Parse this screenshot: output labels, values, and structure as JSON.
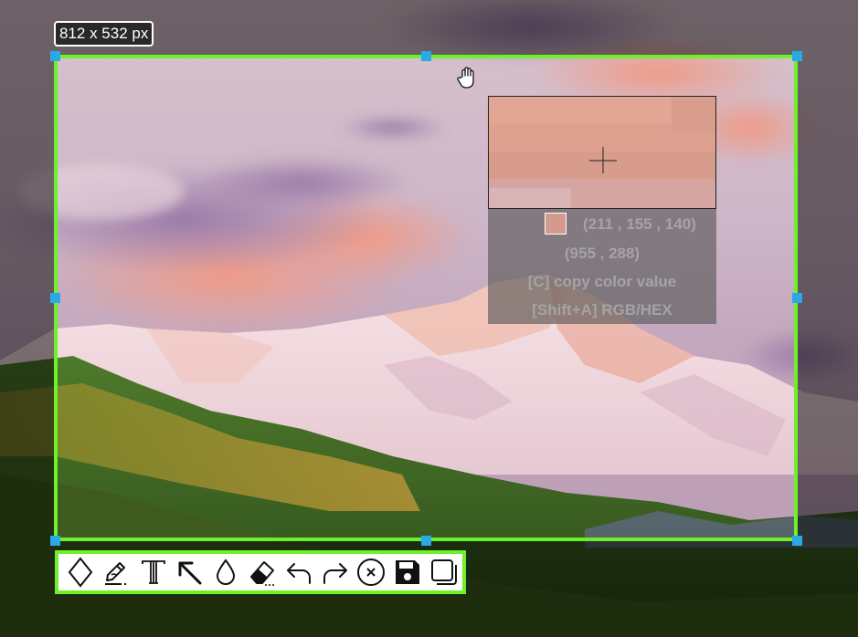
{
  "selection": {
    "size_label": "812 x 532 px"
  },
  "color_picker": {
    "rgb": "(211 , 155 , 140)",
    "position": "(955 , 288)",
    "copy_hint": "[C] copy color value",
    "format_hint": "[Shift+A] RGB/HEX",
    "swatch_color": "#d39b8c"
  },
  "toolbar": {
    "tools": [
      "rect-tool",
      "pen-tool",
      "text-tool",
      "arrow-tool",
      "blur-tool",
      "eraser-tool",
      "undo",
      "redo",
      "cancel",
      "save",
      "copy"
    ]
  },
  "colors": {
    "accent": "#6ef02a",
    "handle": "#2aa9e8"
  }
}
